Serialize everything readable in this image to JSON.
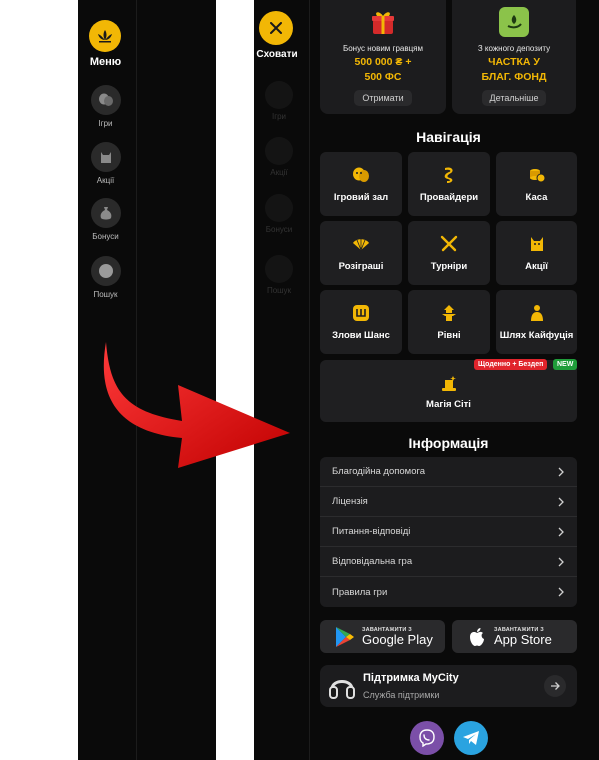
{
  "sidebar_collapsed": {
    "menu_label": "Меню",
    "items": [
      {
        "label": "Ігри",
        "icon": "masks-icon"
      },
      {
        "label": "Акції",
        "icon": "cat-icon"
      },
      {
        "label": "Бонуси",
        "icon": "money-bag-icon"
      },
      {
        "label": "Пошук",
        "icon": "search-icon"
      }
    ]
  },
  "sidebar_expanded": {
    "close_label": "Сховати",
    "ghost_items": [
      {
        "label": "Ігри"
      },
      {
        "label": "Акції"
      },
      {
        "label": "Бонуси"
      },
      {
        "label": "Пошук"
      }
    ]
  },
  "promos": [
    {
      "caption": "Бонус новим гравцям",
      "value_line1": "500 000 ₴ +",
      "value_line2": "500 ФС",
      "button": "Отримати",
      "icon": "gift-icon"
    },
    {
      "caption": "З кожного депозиту",
      "value_line1": "ЧАСТКА У",
      "value_line2": "БЛАГ. ФОНД",
      "button": "Детальніше",
      "icon": "charity-fund-icon"
    }
  ],
  "navigation": {
    "title": "Навігація",
    "tiles": [
      {
        "label": "Ігровий зал",
        "icon": "masks-icon"
      },
      {
        "label": "Провайдери",
        "icon": "dragon-icon"
      },
      {
        "label": "Каса",
        "icon": "coins-icon"
      },
      {
        "label": "Розіграші",
        "icon": "fan-icon"
      },
      {
        "label": "Турніри",
        "icon": "swords-icon"
      },
      {
        "label": "Акції",
        "icon": "cat-icon"
      },
      {
        "label": "Злови Шанс",
        "icon": "chance-icon"
      },
      {
        "label": "Рівні",
        "icon": "pagoda-icon"
      },
      {
        "label": "Шлях Кайфуція",
        "icon": "path-icon"
      }
    ],
    "wide_tile": {
      "label": "Магія Сіті",
      "icon": "magic-hat-icon"
    },
    "badges": {
      "daily": "Щоденно + Бездеп",
      "new": "NEW"
    }
  },
  "information": {
    "title": "Інформація",
    "items": [
      {
        "label": "Благодійна допомога"
      },
      {
        "label": "Ліцензія"
      },
      {
        "label": "Питання-відповіді"
      },
      {
        "label": "Відповідальна гра"
      },
      {
        "label": "Правила гри"
      }
    ]
  },
  "stores": [
    {
      "small": "ЗАВАНТАЖИТИ З",
      "big": "Google Play",
      "icon": "google-play-icon"
    },
    {
      "small": "ЗАВАНТАЖИТИ З",
      "big": "App Store",
      "icon": "apple-icon"
    }
  ],
  "support": {
    "title": "Підтримка MyCity",
    "subtitle": "Служба підтримки"
  },
  "social": [
    {
      "icon": "viber-icon",
      "color": "#7b4fa8"
    },
    {
      "icon": "telegram-icon",
      "color": "#2aa3e0"
    }
  ],
  "colors": {
    "accent": "#f2b705",
    "panel_bg": "#0a0a0a",
    "card_bg": "#1f1f21",
    "arrow": "#e00000",
    "badge_red": "#e0242c",
    "badge_green": "#1f9d3a"
  }
}
